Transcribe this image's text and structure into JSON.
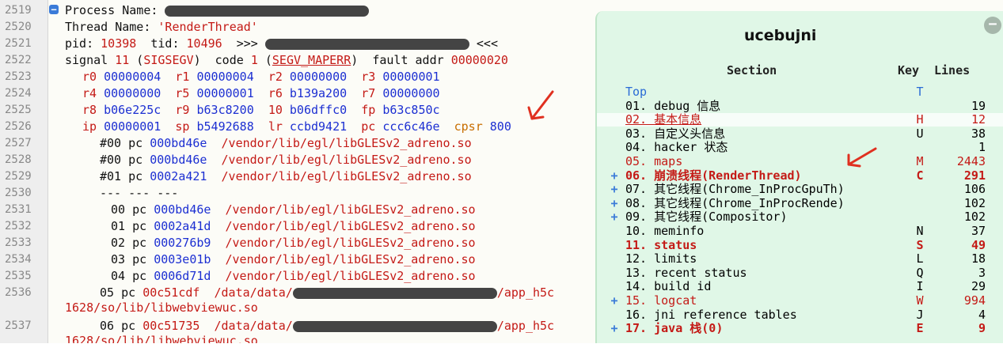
{
  "editor": {
    "line_numbers": [
      "2519",
      "2520",
      "2521",
      "2522",
      "2523",
      "2524",
      "2525",
      "2526",
      "2527",
      "2528",
      "2529",
      "2530",
      "2531",
      "2532",
      "2533",
      "2534",
      "2535",
      "2536",
      "",
      "2537",
      ""
    ],
    "lines": {
      "l2519_a": "Process Name: ",
      "l2520_a": "Thread Name: ",
      "l2520_b": "'RenderThread'",
      "l2521_a": "pid: ",
      "l2521_b": "10398",
      "l2521_c": "  tid: ",
      "l2521_d": "10496",
      "l2521_e": "  >>> ",
      "l2521_f": " <<<",
      "l2522_a": "signal ",
      "l2522_b": "11",
      "l2522_c": " (",
      "l2522_d": "SIGSEGV",
      "l2522_e": ")  code ",
      "l2522_f": "1",
      "l2522_g": " (",
      "l2522_h": "SEGV_MAPERR",
      "l2522_i": ")  fault addr ",
      "l2522_j": "00000020",
      "regs": [
        [
          [
            "r0",
            "00000004"
          ],
          [
            "r1",
            "00000004"
          ],
          [
            "r2",
            "00000000"
          ],
          [
            "r3",
            "00000001"
          ]
        ],
        [
          [
            "r4",
            "00000000"
          ],
          [
            "r5",
            "00000001"
          ],
          [
            "r6",
            "b139a200"
          ],
          [
            "r7",
            "00000000"
          ]
        ],
        [
          [
            "r8",
            "b06e225c"
          ],
          [
            "r9",
            "b63c8200"
          ],
          [
            "10",
            "b06dffc0"
          ],
          [
            "fp",
            "b63c850c"
          ]
        ],
        [
          [
            "ip",
            "00000001"
          ],
          [
            "sp",
            "b5492688"
          ],
          [
            "lr",
            "ccbd9421"
          ],
          [
            "pc",
            "ccc6c46e"
          ],
          [
            "cpsr",
            "800"
          ]
        ]
      ],
      "bt1": [
        [
          "#00",
          "pc",
          "000bd46e",
          "/vendor/lib/egl/libGLESv2_adreno.so"
        ],
        [
          "#00",
          "pc",
          "000bd46e",
          "/vendor/lib/egl/libGLESv2_adreno.so"
        ],
        [
          "#01",
          "pc",
          "0002a421",
          "/vendor/lib/egl/libGLESv2_adreno.so"
        ]
      ],
      "sep": "--- --- ---",
      "bt2": [
        [
          "00",
          "pc",
          "000bd46e",
          "/vendor/lib/egl/libGLESv2_adreno.so"
        ],
        [
          "01",
          "pc",
          "0002a41d",
          "/vendor/lib/egl/libGLESv2_adreno.so"
        ],
        [
          "02",
          "pc",
          "000276b9",
          "/vendor/lib/egl/libGLESv2_adreno.so"
        ],
        [
          "03",
          "pc",
          "0003e01b",
          "/vendor/lib/egl/libGLESv2_adreno.so"
        ],
        [
          "04",
          "pc",
          "0006d71d",
          "/vendor/lib/egl/libGLESv2_adreno.so"
        ]
      ],
      "l2536_a": "05 pc ",
      "l2536_b": "00c51cdf",
      "l2536_c": "  /data/data/",
      "l2536_d": "/app_h5c",
      "l2536_cont": "1628/so/lib/libwebviewuc.so",
      "l2537_a": "06 pc ",
      "l2537_b": "00c51735",
      "l2537_c": "  /data/data/",
      "l2537_d": "/app_h5c",
      "l2537_cont": "1628/so/lib/libwebviewuc.so"
    }
  },
  "toc": {
    "title": "ucebujni",
    "close": "−",
    "col_section": "Section",
    "col_key": "Key",
    "col_lines": "Lines",
    "rows": [
      {
        "plus": "",
        "label": "Top",
        "key": "T",
        "lines": "",
        "style": "lnk"
      },
      {
        "plus": "",
        "label": "01. debug 信息",
        "key": "",
        "lines": "19",
        "style": ""
      },
      {
        "plus": "",
        "label": "02. 基本信息",
        "key": "H",
        "lines": "12",
        "style": "r"
      },
      {
        "plus": "",
        "label": "03. 自定义头信息",
        "key": "U",
        "lines": "38",
        "style": ""
      },
      {
        "plus": "",
        "label": "04. hacker 状态",
        "key": "",
        "lines": "1",
        "style": ""
      },
      {
        "plus": "",
        "label": "05. maps",
        "key": "M",
        "lines": "2443",
        "style": "r"
      },
      {
        "plus": "+",
        "label": "06. 崩溃线程(RenderThread)",
        "key": "C",
        "lines": "291",
        "style": "rb"
      },
      {
        "plus": "+",
        "label": "07. 其它线程(Chrome_InProcGpuTh)",
        "key": "",
        "lines": "106",
        "style": ""
      },
      {
        "plus": "+",
        "label": "08. 其它线程(Chrome_InProcRende)",
        "key": "",
        "lines": "102",
        "style": ""
      },
      {
        "plus": "+",
        "label": "09. 其它线程(Compositor)",
        "key": "",
        "lines": "102",
        "style": ""
      },
      {
        "plus": "",
        "label": "10. meminfo",
        "key": "N",
        "lines": "37",
        "style": ""
      },
      {
        "plus": "",
        "label": "11. status",
        "key": "S",
        "lines": "49",
        "style": "rb"
      },
      {
        "plus": "",
        "label": "12. limits",
        "key": "L",
        "lines": "18",
        "style": ""
      },
      {
        "plus": "",
        "label": "13. recent status",
        "key": "Q",
        "lines": "3",
        "style": ""
      },
      {
        "plus": "",
        "label": "14. build id",
        "key": "I",
        "lines": "29",
        "style": ""
      },
      {
        "plus": "+",
        "label": "15. logcat",
        "key": "W",
        "lines": "994",
        "style": "r"
      },
      {
        "plus": "",
        "label": "16. jni reference tables",
        "key": "J",
        "lines": "4",
        "style": ""
      },
      {
        "plus": "+",
        "label": "17. java 栈(0)",
        "key": "E",
        "lines": "9",
        "style": "rb"
      }
    ]
  },
  "colors": {
    "accent_red": "#c41a16",
    "number_blue": "#1c2fd2",
    "panel_green": "#def7e6",
    "arrow_red": "#e03020"
  }
}
